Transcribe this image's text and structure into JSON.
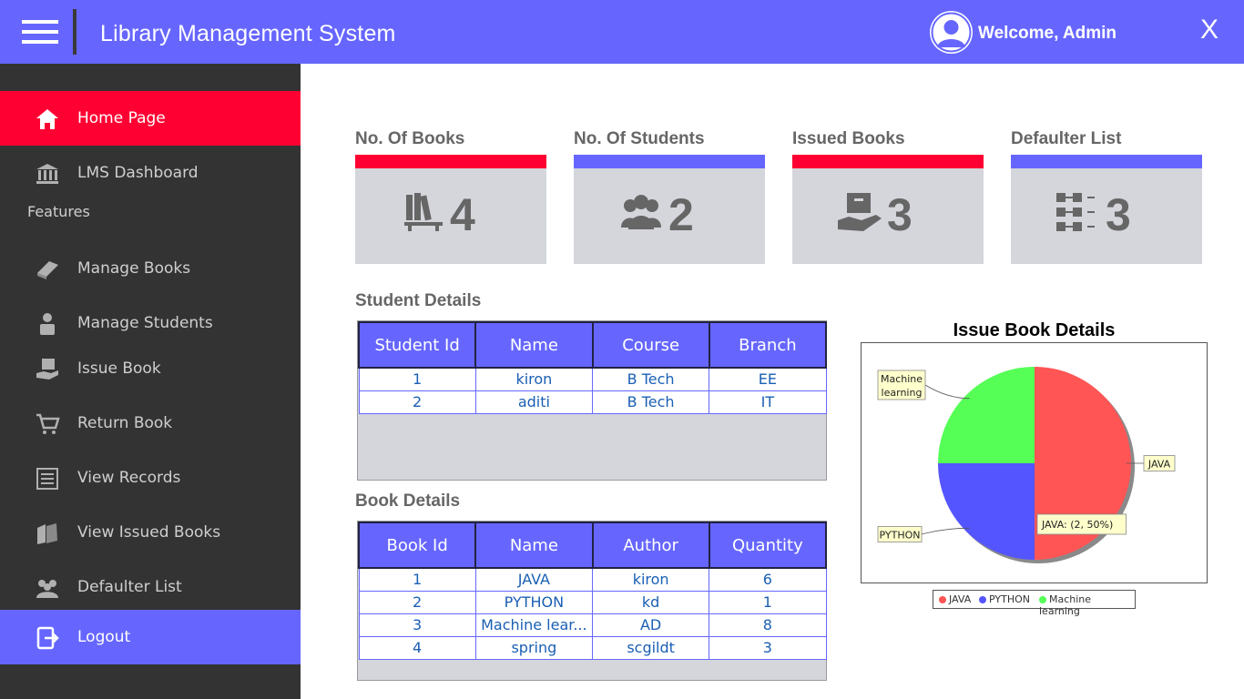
{
  "header": {
    "title": "Library Management System",
    "welcome": "Welcome, Admin",
    "close_label": "X"
  },
  "sidebar": {
    "items": [
      {
        "label": "Home Page",
        "icon": "home-icon"
      },
      {
        "label": "LMS Dashboard",
        "icon": "bank-icon"
      },
      {
        "label": "Manage Books",
        "icon": "book-icon"
      },
      {
        "label": "Manage Students",
        "icon": "student-icon"
      },
      {
        "label": "Issue Book",
        "icon": "hand-book-icon"
      },
      {
        "label": "Return Book",
        "icon": "cart-return-icon"
      },
      {
        "label": "View Records",
        "icon": "list-icon"
      },
      {
        "label": "View Issued Books",
        "icon": "books-icon"
      },
      {
        "label": "Defaulter List",
        "icon": "people-icon"
      },
      {
        "label": "Logout",
        "icon": "logout-icon"
      }
    ],
    "features_label": "Features"
  },
  "stats": [
    {
      "title": "No. Of Books",
      "count": "4",
      "icon": "bookshelf-icon"
    },
    {
      "title": "No. Of Students",
      "count": "2",
      "icon": "group-icon"
    },
    {
      "title": "Issued Books",
      "count": "3",
      "icon": "box-hand-icon"
    },
    {
      "title": "Defaulter List",
      "count": "3",
      "icon": "checklist-icon"
    }
  ],
  "student_details": {
    "title": "Student Details",
    "columns": [
      "Student Id",
      "Name",
      "Course",
      "Branch"
    ],
    "rows": [
      [
        "1",
        "kiron",
        "B Tech",
        "EE"
      ],
      [
        "2",
        "aditi",
        "B Tech",
        "IT"
      ]
    ]
  },
  "book_details": {
    "title": "Book Details",
    "columns": [
      "Book Id",
      "Name",
      "Author",
      "Quantity"
    ],
    "rows": [
      [
        "1",
        "JAVA",
        "kiron",
        "6"
      ],
      [
        "2",
        "PYTHON",
        "kd",
        "1"
      ],
      [
        "3",
        "Machine lear...",
        "AD",
        "8"
      ],
      [
        "4",
        "spring",
        "scgildt",
        "3"
      ]
    ]
  },
  "chart_data": {
    "type": "pie",
    "title": "Issue Book Details",
    "categories": [
      "JAVA",
      "PYTHON",
      "Machine learning"
    ],
    "values": [
      2,
      1,
      1
    ],
    "colors": [
      "#ff5555",
      "#5555ff",
      "#55ff55"
    ],
    "tooltip": "JAVA: (2, 50%)",
    "legend_position": "bottom",
    "slice_labels": [
      "JAVA",
      "PYTHON",
      "Machine learning"
    ]
  }
}
